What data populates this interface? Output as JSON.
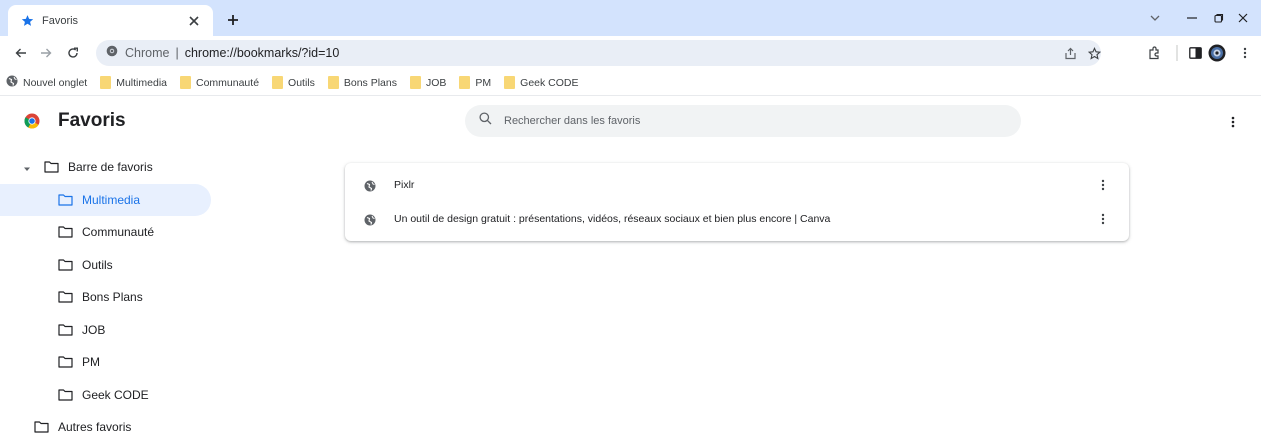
{
  "tab": {
    "title": "Favoris",
    "favicon": "star-icon",
    "accent": "#1a73e8"
  },
  "window": {
    "tabstrip_color": "#d3e3fd"
  },
  "omnibox": {
    "site": "Chrome",
    "separator": "|",
    "url": "chrome://bookmarks/?id=10"
  },
  "bookmarks_bar": {
    "items": [
      {
        "label": "Nouvel onglet",
        "icon": "globe-icon"
      },
      {
        "label": "Multimedia",
        "icon": "folder-icon"
      },
      {
        "label": "Communauté",
        "icon": "folder-icon"
      },
      {
        "label": "Outils",
        "icon": "folder-icon"
      },
      {
        "label": "Bons Plans",
        "icon": "folder-icon"
      },
      {
        "label": "JOB",
        "icon": "folder-icon"
      },
      {
        "label": "PM",
        "icon": "folder-icon"
      },
      {
        "label": "Geek CODE",
        "icon": "folder-icon"
      }
    ]
  },
  "header": {
    "title": "Favoris",
    "search_placeholder": "Rechercher dans les favoris"
  },
  "sidebar": {
    "root": "Barre de favoris",
    "items": [
      {
        "label": "Multimedia",
        "selected": true
      },
      {
        "label": "Communauté"
      },
      {
        "label": "Outils"
      },
      {
        "label": "Bons Plans"
      },
      {
        "label": "JOB"
      },
      {
        "label": "PM"
      },
      {
        "label": "Geek CODE"
      }
    ],
    "other": "Autres favoris",
    "selected_color": "#e8f0fe"
  },
  "list": {
    "items": [
      {
        "title": "Pixlr"
      },
      {
        "title": "Un outil de design gratuit : présentations, vidéos, réseaux sociaux et bien plus encore | Canva"
      }
    ]
  }
}
